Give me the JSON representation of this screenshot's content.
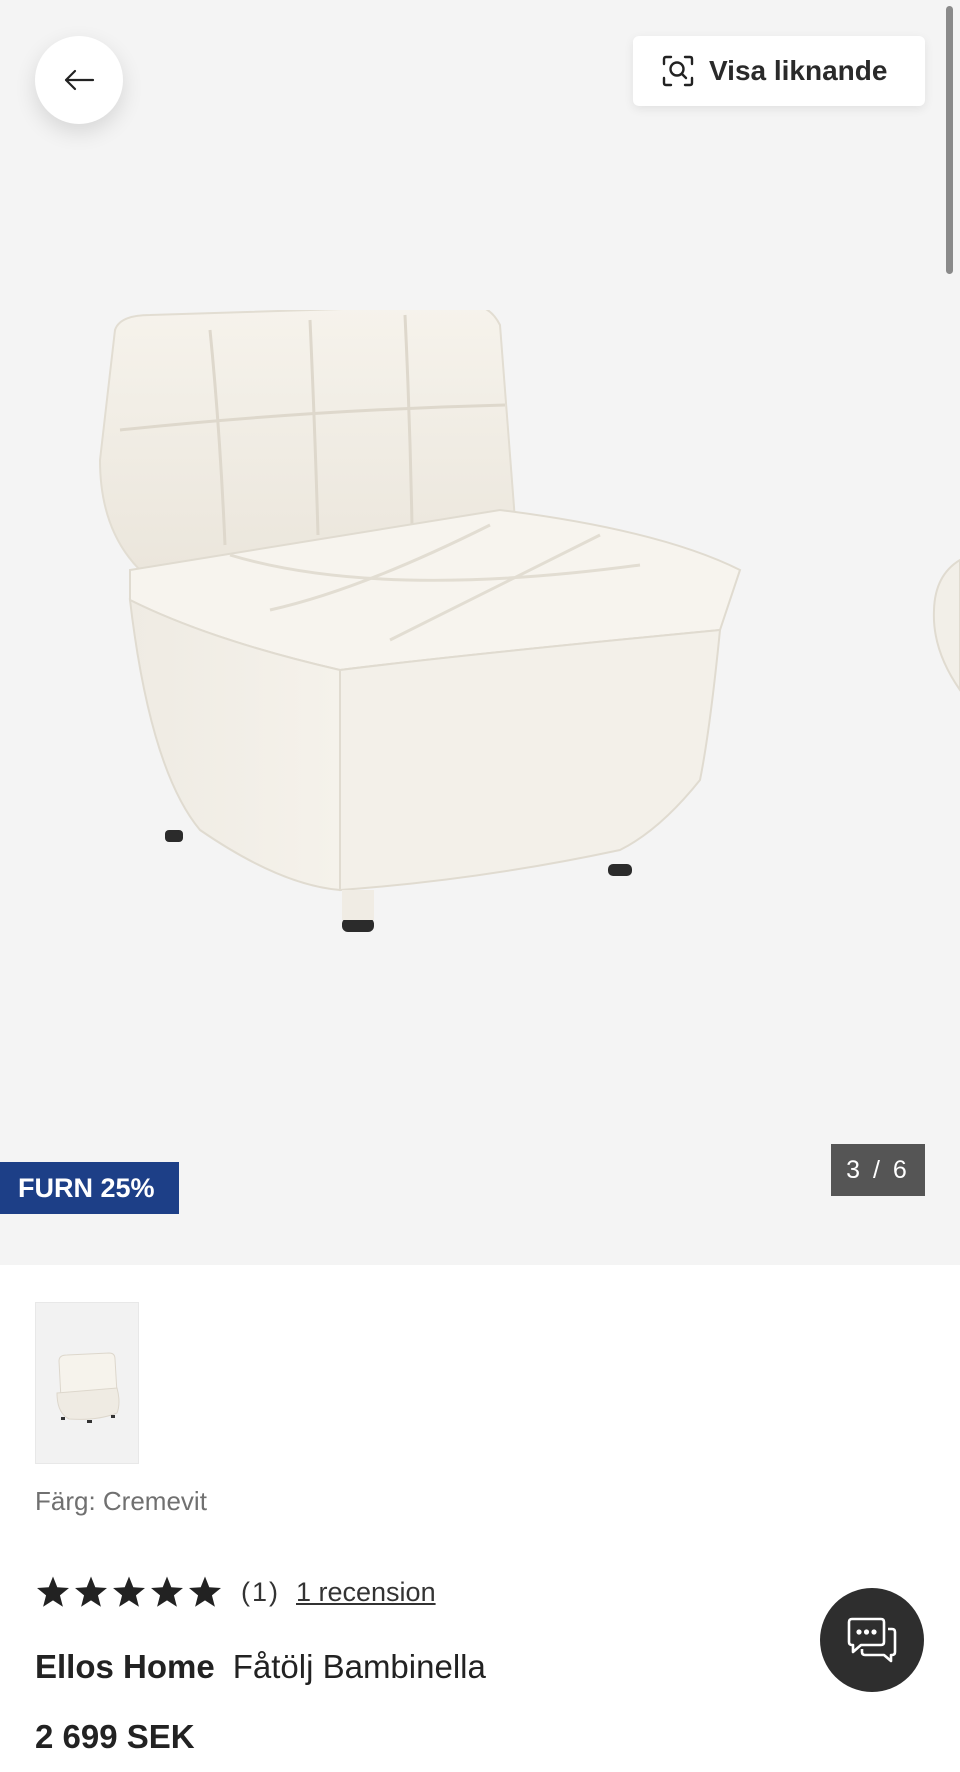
{
  "header": {
    "back_icon": "arrow-left-icon",
    "similar_label": "Visa liknande",
    "similar_icon": "visual-search-icon"
  },
  "gallery": {
    "promo_badge": "FURN 25%",
    "promo_color": "#1d3f87",
    "counter": "3 / 6",
    "image_subject": "cream boucle armchair"
  },
  "product": {
    "color_label": "Färg: Cremevit",
    "rating": {
      "stars": 5,
      "count": "(1)",
      "reviews_link": "1 recension"
    },
    "brand": "Ellos Home",
    "name": "Fåtölj Bambinella",
    "price": "2 699 SEK"
  },
  "chat": {
    "icon": "chat-bubbles-icon"
  }
}
